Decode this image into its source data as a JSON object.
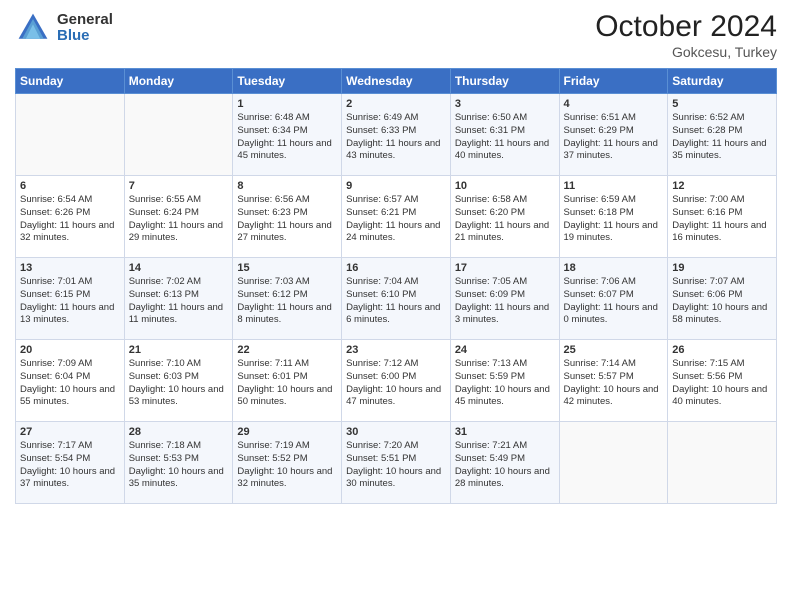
{
  "header": {
    "logo_general": "General",
    "logo_blue": "Blue",
    "month_title": "October 2024",
    "subtitle": "Gokcesu, Turkey"
  },
  "days_of_week": [
    "Sunday",
    "Monday",
    "Tuesday",
    "Wednesday",
    "Thursday",
    "Friday",
    "Saturday"
  ],
  "weeks": [
    [
      {
        "day": "",
        "sunrise": "",
        "sunset": "",
        "daylight": ""
      },
      {
        "day": "",
        "sunrise": "",
        "sunset": "",
        "daylight": ""
      },
      {
        "day": "1",
        "sunrise": "Sunrise: 6:48 AM",
        "sunset": "Sunset: 6:34 PM",
        "daylight": "Daylight: 11 hours and 45 minutes."
      },
      {
        "day": "2",
        "sunrise": "Sunrise: 6:49 AM",
        "sunset": "Sunset: 6:33 PM",
        "daylight": "Daylight: 11 hours and 43 minutes."
      },
      {
        "day": "3",
        "sunrise": "Sunrise: 6:50 AM",
        "sunset": "Sunset: 6:31 PM",
        "daylight": "Daylight: 11 hours and 40 minutes."
      },
      {
        "day": "4",
        "sunrise": "Sunrise: 6:51 AM",
        "sunset": "Sunset: 6:29 PM",
        "daylight": "Daylight: 11 hours and 37 minutes."
      },
      {
        "day": "5",
        "sunrise": "Sunrise: 6:52 AM",
        "sunset": "Sunset: 6:28 PM",
        "daylight": "Daylight: 11 hours and 35 minutes."
      }
    ],
    [
      {
        "day": "6",
        "sunrise": "Sunrise: 6:54 AM",
        "sunset": "Sunset: 6:26 PM",
        "daylight": "Daylight: 11 hours and 32 minutes."
      },
      {
        "day": "7",
        "sunrise": "Sunrise: 6:55 AM",
        "sunset": "Sunset: 6:24 PM",
        "daylight": "Daylight: 11 hours and 29 minutes."
      },
      {
        "day": "8",
        "sunrise": "Sunrise: 6:56 AM",
        "sunset": "Sunset: 6:23 PM",
        "daylight": "Daylight: 11 hours and 27 minutes."
      },
      {
        "day": "9",
        "sunrise": "Sunrise: 6:57 AM",
        "sunset": "Sunset: 6:21 PM",
        "daylight": "Daylight: 11 hours and 24 minutes."
      },
      {
        "day": "10",
        "sunrise": "Sunrise: 6:58 AM",
        "sunset": "Sunset: 6:20 PM",
        "daylight": "Daylight: 11 hours and 21 minutes."
      },
      {
        "day": "11",
        "sunrise": "Sunrise: 6:59 AM",
        "sunset": "Sunset: 6:18 PM",
        "daylight": "Daylight: 11 hours and 19 minutes."
      },
      {
        "day": "12",
        "sunrise": "Sunrise: 7:00 AM",
        "sunset": "Sunset: 6:16 PM",
        "daylight": "Daylight: 11 hours and 16 minutes."
      }
    ],
    [
      {
        "day": "13",
        "sunrise": "Sunrise: 7:01 AM",
        "sunset": "Sunset: 6:15 PM",
        "daylight": "Daylight: 11 hours and 13 minutes."
      },
      {
        "day": "14",
        "sunrise": "Sunrise: 7:02 AM",
        "sunset": "Sunset: 6:13 PM",
        "daylight": "Daylight: 11 hours and 11 minutes."
      },
      {
        "day": "15",
        "sunrise": "Sunrise: 7:03 AM",
        "sunset": "Sunset: 6:12 PM",
        "daylight": "Daylight: 11 hours and 8 minutes."
      },
      {
        "day": "16",
        "sunrise": "Sunrise: 7:04 AM",
        "sunset": "Sunset: 6:10 PM",
        "daylight": "Daylight: 11 hours and 6 minutes."
      },
      {
        "day": "17",
        "sunrise": "Sunrise: 7:05 AM",
        "sunset": "Sunset: 6:09 PM",
        "daylight": "Daylight: 11 hours and 3 minutes."
      },
      {
        "day": "18",
        "sunrise": "Sunrise: 7:06 AM",
        "sunset": "Sunset: 6:07 PM",
        "daylight": "Daylight: 11 hours and 0 minutes."
      },
      {
        "day": "19",
        "sunrise": "Sunrise: 7:07 AM",
        "sunset": "Sunset: 6:06 PM",
        "daylight": "Daylight: 10 hours and 58 minutes."
      }
    ],
    [
      {
        "day": "20",
        "sunrise": "Sunrise: 7:09 AM",
        "sunset": "Sunset: 6:04 PM",
        "daylight": "Daylight: 10 hours and 55 minutes."
      },
      {
        "day": "21",
        "sunrise": "Sunrise: 7:10 AM",
        "sunset": "Sunset: 6:03 PM",
        "daylight": "Daylight: 10 hours and 53 minutes."
      },
      {
        "day": "22",
        "sunrise": "Sunrise: 7:11 AM",
        "sunset": "Sunset: 6:01 PM",
        "daylight": "Daylight: 10 hours and 50 minutes."
      },
      {
        "day": "23",
        "sunrise": "Sunrise: 7:12 AM",
        "sunset": "Sunset: 6:00 PM",
        "daylight": "Daylight: 10 hours and 47 minutes."
      },
      {
        "day": "24",
        "sunrise": "Sunrise: 7:13 AM",
        "sunset": "Sunset: 5:59 PM",
        "daylight": "Daylight: 10 hours and 45 minutes."
      },
      {
        "day": "25",
        "sunrise": "Sunrise: 7:14 AM",
        "sunset": "Sunset: 5:57 PM",
        "daylight": "Daylight: 10 hours and 42 minutes."
      },
      {
        "day": "26",
        "sunrise": "Sunrise: 7:15 AM",
        "sunset": "Sunset: 5:56 PM",
        "daylight": "Daylight: 10 hours and 40 minutes."
      }
    ],
    [
      {
        "day": "27",
        "sunrise": "Sunrise: 7:17 AM",
        "sunset": "Sunset: 5:54 PM",
        "daylight": "Daylight: 10 hours and 37 minutes."
      },
      {
        "day": "28",
        "sunrise": "Sunrise: 7:18 AM",
        "sunset": "Sunset: 5:53 PM",
        "daylight": "Daylight: 10 hours and 35 minutes."
      },
      {
        "day": "29",
        "sunrise": "Sunrise: 7:19 AM",
        "sunset": "Sunset: 5:52 PM",
        "daylight": "Daylight: 10 hours and 32 minutes."
      },
      {
        "day": "30",
        "sunrise": "Sunrise: 7:20 AM",
        "sunset": "Sunset: 5:51 PM",
        "daylight": "Daylight: 10 hours and 30 minutes."
      },
      {
        "day": "31",
        "sunrise": "Sunrise: 7:21 AM",
        "sunset": "Sunset: 5:49 PM",
        "daylight": "Daylight: 10 hours and 28 minutes."
      },
      {
        "day": "",
        "sunrise": "",
        "sunset": "",
        "daylight": ""
      },
      {
        "day": "",
        "sunrise": "",
        "sunset": "",
        "daylight": ""
      }
    ]
  ]
}
